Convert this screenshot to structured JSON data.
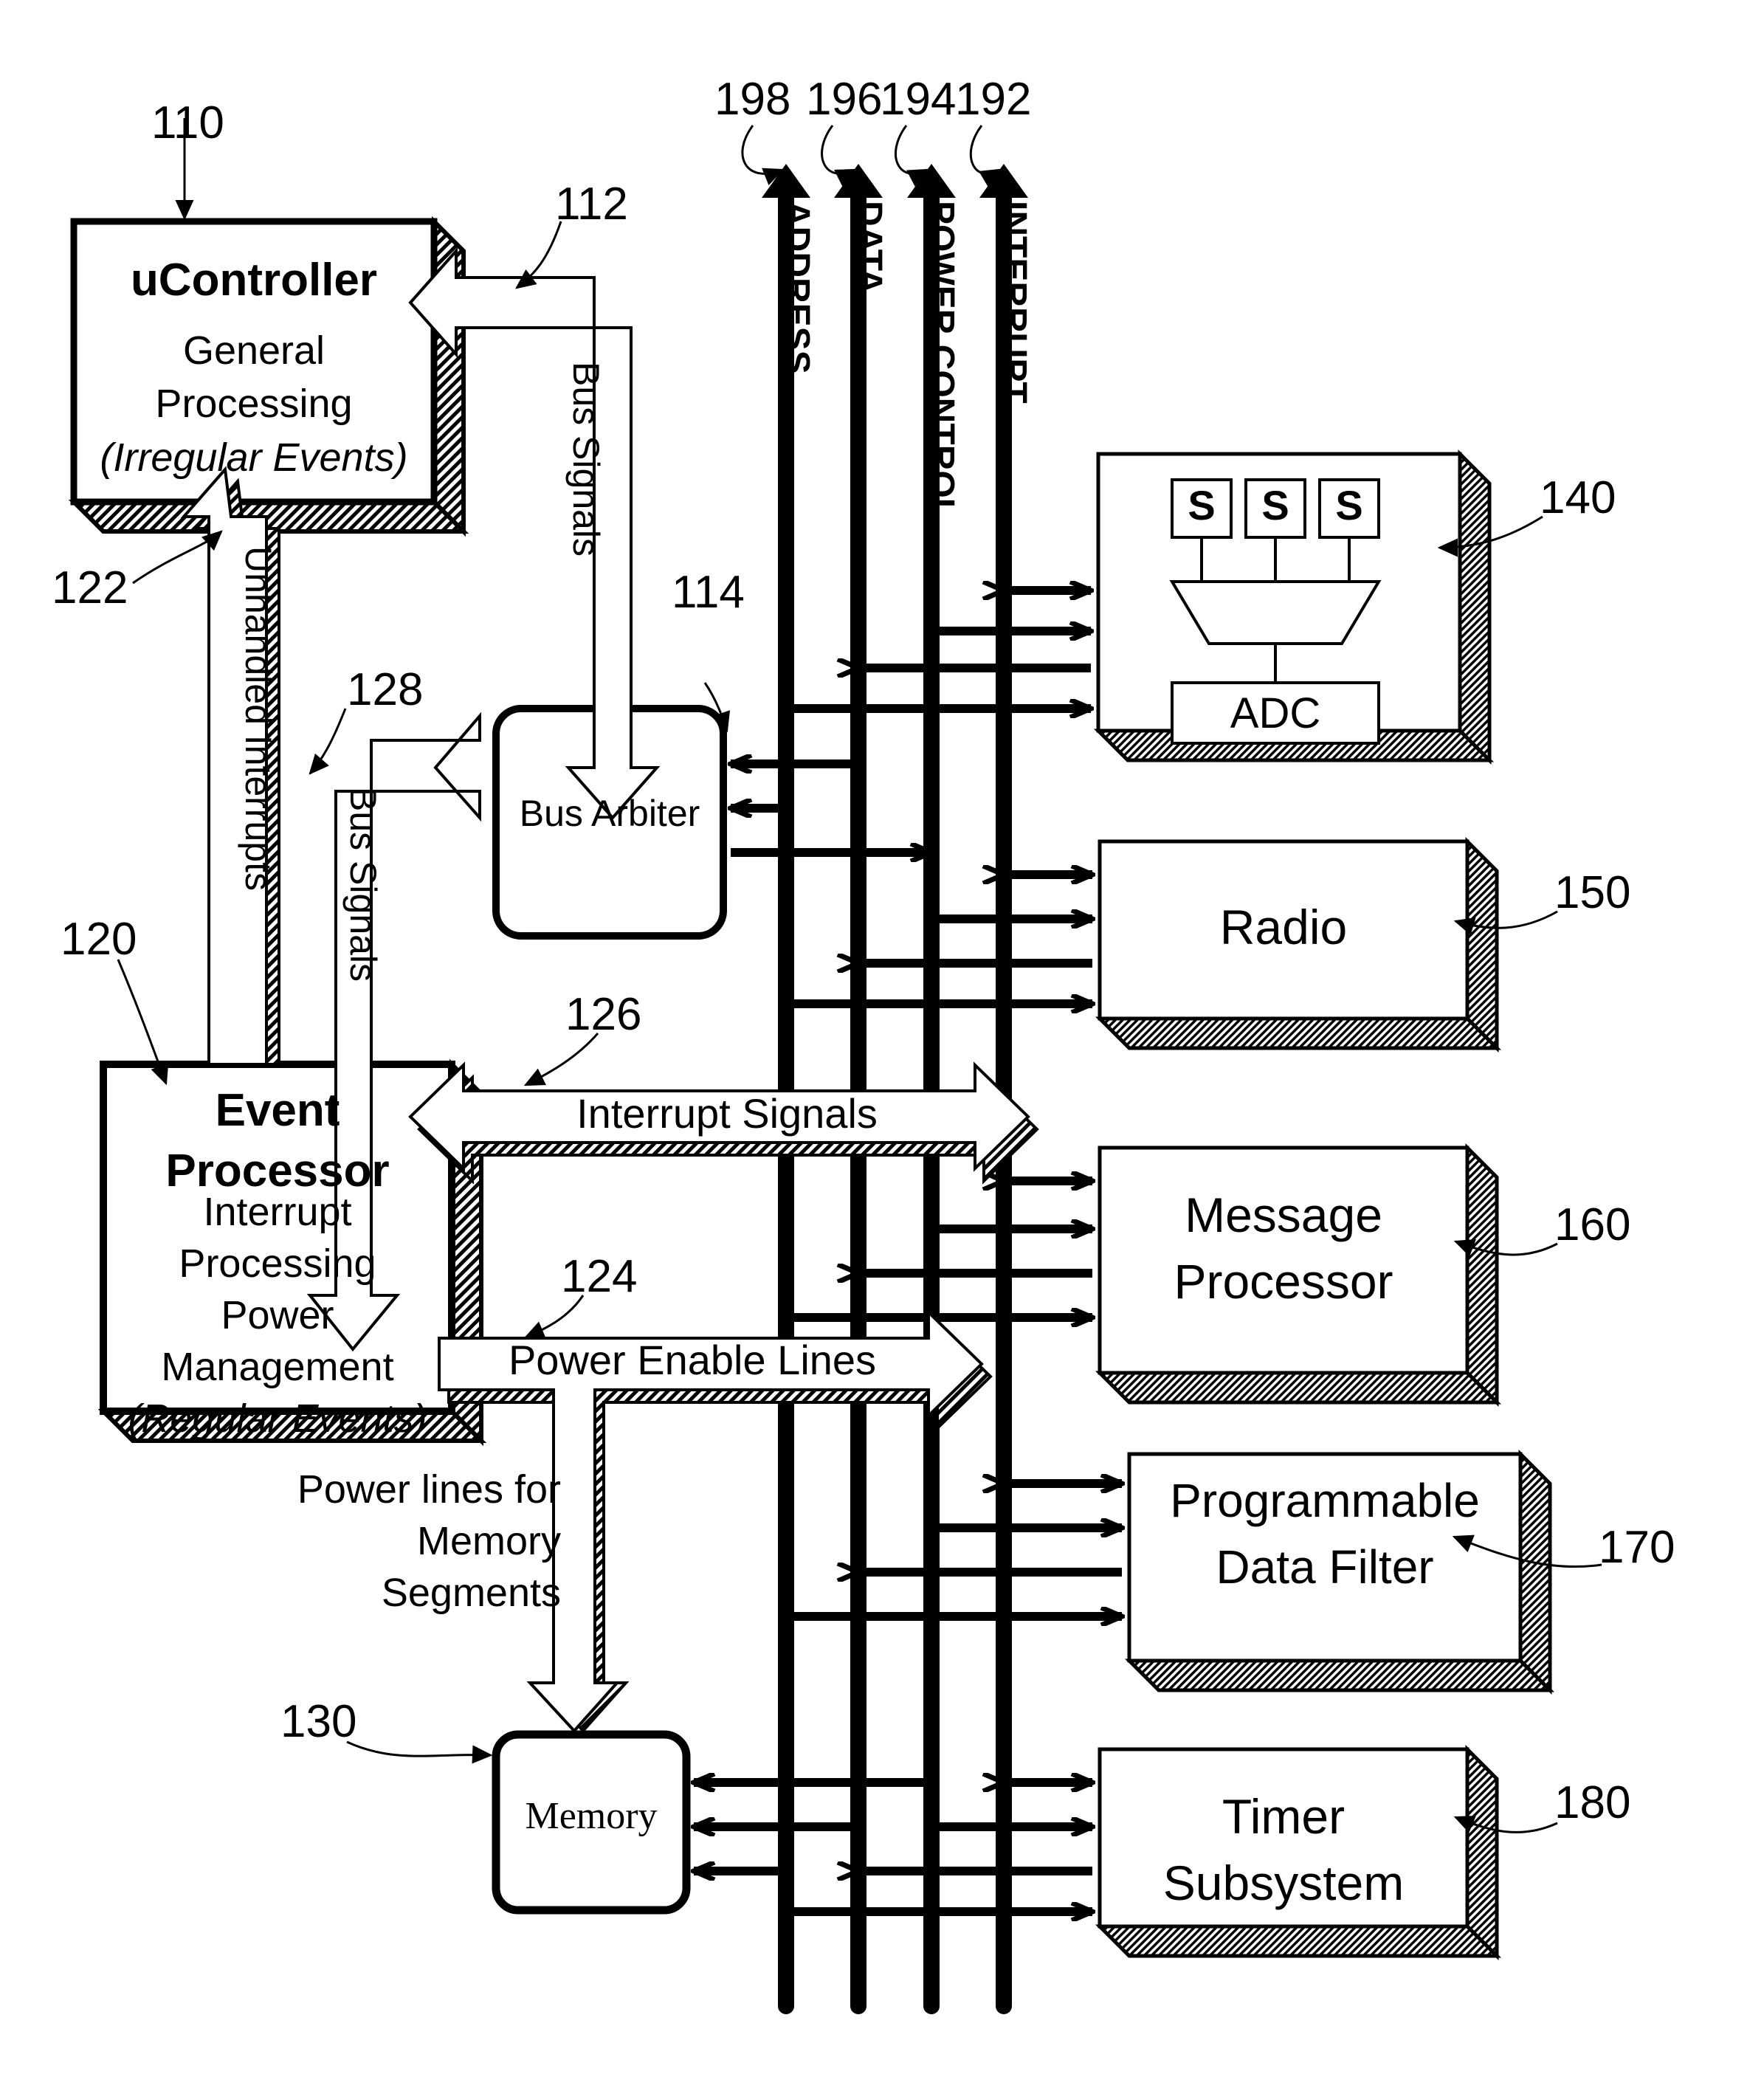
{
  "figure": {
    "type": "patent-block-diagram",
    "background": "#ffffff",
    "ink": "#000000"
  },
  "blocks": {
    "ucontroller": {
      "ref": "110",
      "title": "uController",
      "line1": "General",
      "line2": "Processing",
      "line3": "(Irregular Events)"
    },
    "event_processor": {
      "ref": "120",
      "title1": "Event",
      "title2": "Processor",
      "line1": "Interrupt",
      "line2": "Processing",
      "line3": "Power",
      "line4": "Management",
      "line5": "(Regular Events)"
    },
    "bus_arbiter": {
      "ref": "114",
      "label": "Bus Arbiter"
    },
    "memory": {
      "ref": "130",
      "label": "Memory"
    },
    "sensor_block": {
      "ref": "140",
      "sensors": [
        "S",
        "S",
        "S"
      ],
      "adc_label": "ADC"
    },
    "radio": {
      "ref": "150",
      "label": "Radio"
    },
    "message_processor": {
      "ref": "160",
      "line1": "Message",
      "line2": "Processor"
    },
    "data_filter": {
      "ref": "170",
      "line1": "Programmable",
      "line2": "Data Filter"
    },
    "timer": {
      "ref": "180",
      "line1": "Timer",
      "line2": "Subsystem"
    }
  },
  "buses": [
    {
      "ref": "198",
      "label": "ADDRESS"
    },
    {
      "ref": "196",
      "label": "DATA"
    },
    {
      "ref": "194",
      "label": "POWER CONTROL"
    },
    {
      "ref": "192",
      "label": "INTERRUPT"
    }
  ],
  "signal_arrows": {
    "bus_signals_upper": {
      "ref": "112",
      "label": "Bus Signals"
    },
    "bus_signals_lower": {
      "ref": "128",
      "label": "Bus Signals"
    },
    "unhandled_interrupts": {
      "ref": "122",
      "label": "Unhandled Interrupts"
    },
    "interrupt_signals": {
      "ref": "126",
      "label": "Interrupt Signals"
    },
    "power_enable_lines": {
      "ref": "124",
      "label": "Power Enable Lines"
    },
    "power_memory": {
      "line1": "Power lines for",
      "line2": "Memory",
      "line3": "Segments"
    }
  }
}
